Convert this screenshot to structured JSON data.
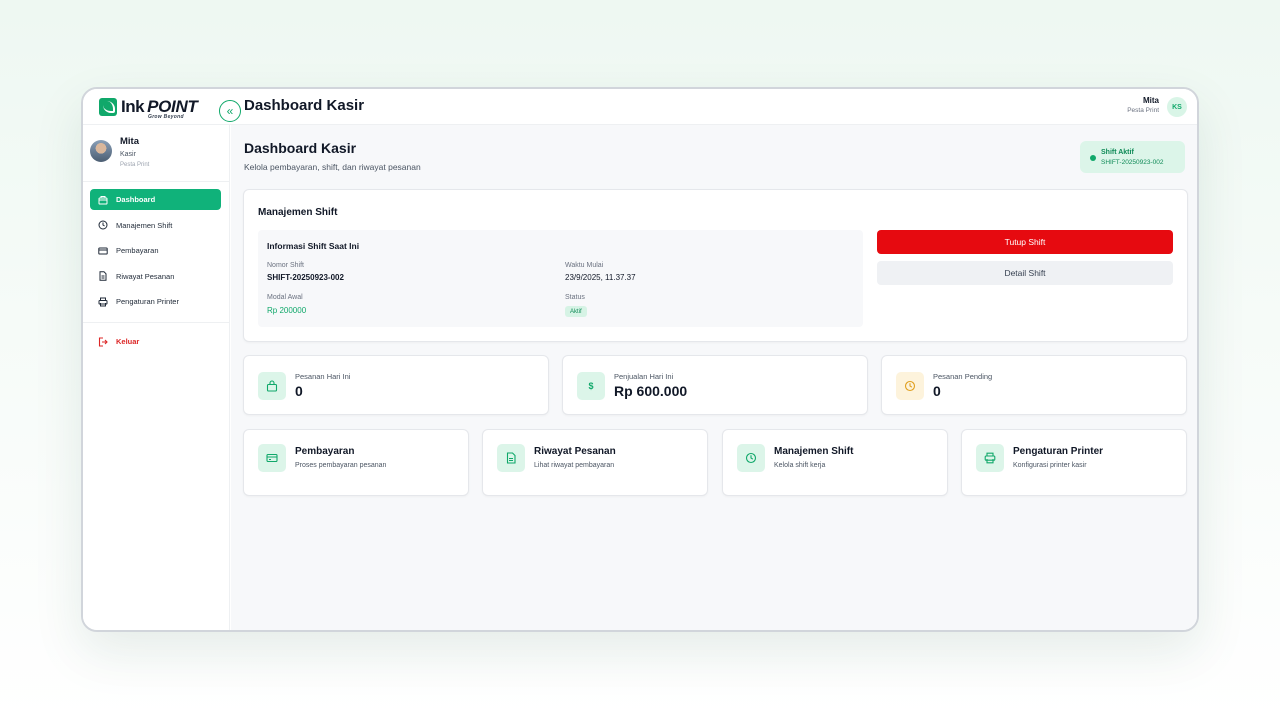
{
  "app": {
    "logo_ink": "Ink",
    "logo_point": "POINT",
    "logo_tagline": "Grow Beyond",
    "topbar_title": "Dashboard Kasir"
  },
  "user": {
    "name": "Mita",
    "role": "Kasir",
    "store": "Pesta Print",
    "initials": "KS"
  },
  "sidebar": {
    "items": [
      {
        "label": "Dashboard",
        "icon": "store-icon",
        "active": true
      },
      {
        "label": "Manajemen Shift",
        "icon": "clock-icon",
        "active": false
      },
      {
        "label": "Pembayaran",
        "icon": "card-icon",
        "active": false
      },
      {
        "label": "Riwayat Pesanan",
        "icon": "document-icon",
        "active": false
      },
      {
        "label": "Pengaturan Printer",
        "icon": "printer-icon",
        "active": false
      }
    ],
    "logout_label": "Keluar"
  },
  "main": {
    "title": "Dashboard Kasir",
    "subtitle": "Kelola pembayaran, shift, dan riwayat pesanan",
    "shift_badge": {
      "label": "Shift Aktif",
      "code": "SHIFT-20250923-002"
    }
  },
  "shift_card": {
    "header": "Manajemen Shift",
    "info_title": "Informasi Shift Saat Ini",
    "fields": {
      "nomor_label": "Nomor Shift",
      "nomor_value": "SHIFT-20250923-002",
      "waktu_label": "Waktu Mulai",
      "waktu_value": "23/9/2025, 11.37.37",
      "modal_label": "Modal Awal",
      "modal_value": "Rp 200000",
      "status_label": "Status",
      "status_value": "Aktif"
    },
    "close_button": "Tutup Shift",
    "detail_button": "Detail Shift"
  },
  "stats": [
    {
      "label": "Pesanan Hari Ini",
      "value": "0",
      "icon": "bag-icon"
    },
    {
      "label": "Penjualan Hari Ini",
      "value": "Rp 600.000",
      "icon": "dollar-icon"
    },
    {
      "label": "Pesanan Pending",
      "value": "0",
      "icon": "clock-icon"
    }
  ],
  "quick_links": [
    {
      "title": "Pembayaran",
      "subtitle": "Proses pembayaran pesanan",
      "icon": "card-icon"
    },
    {
      "title": "Riwayat Pesanan",
      "subtitle": "Lihat riwayat pembayaran",
      "icon": "document-icon"
    },
    {
      "title": "Manajemen Shift",
      "subtitle": "Kelola shift kerja",
      "icon": "clock-icon"
    },
    {
      "title": "Pengaturan Printer",
      "subtitle": "Konfigurasi printer kasir",
      "icon": "printer-icon"
    }
  ],
  "colors": {
    "accent": "#10b27a",
    "danger": "#e60a10",
    "warning_bg": "#fdf3dc",
    "warning": "#e0a020"
  }
}
